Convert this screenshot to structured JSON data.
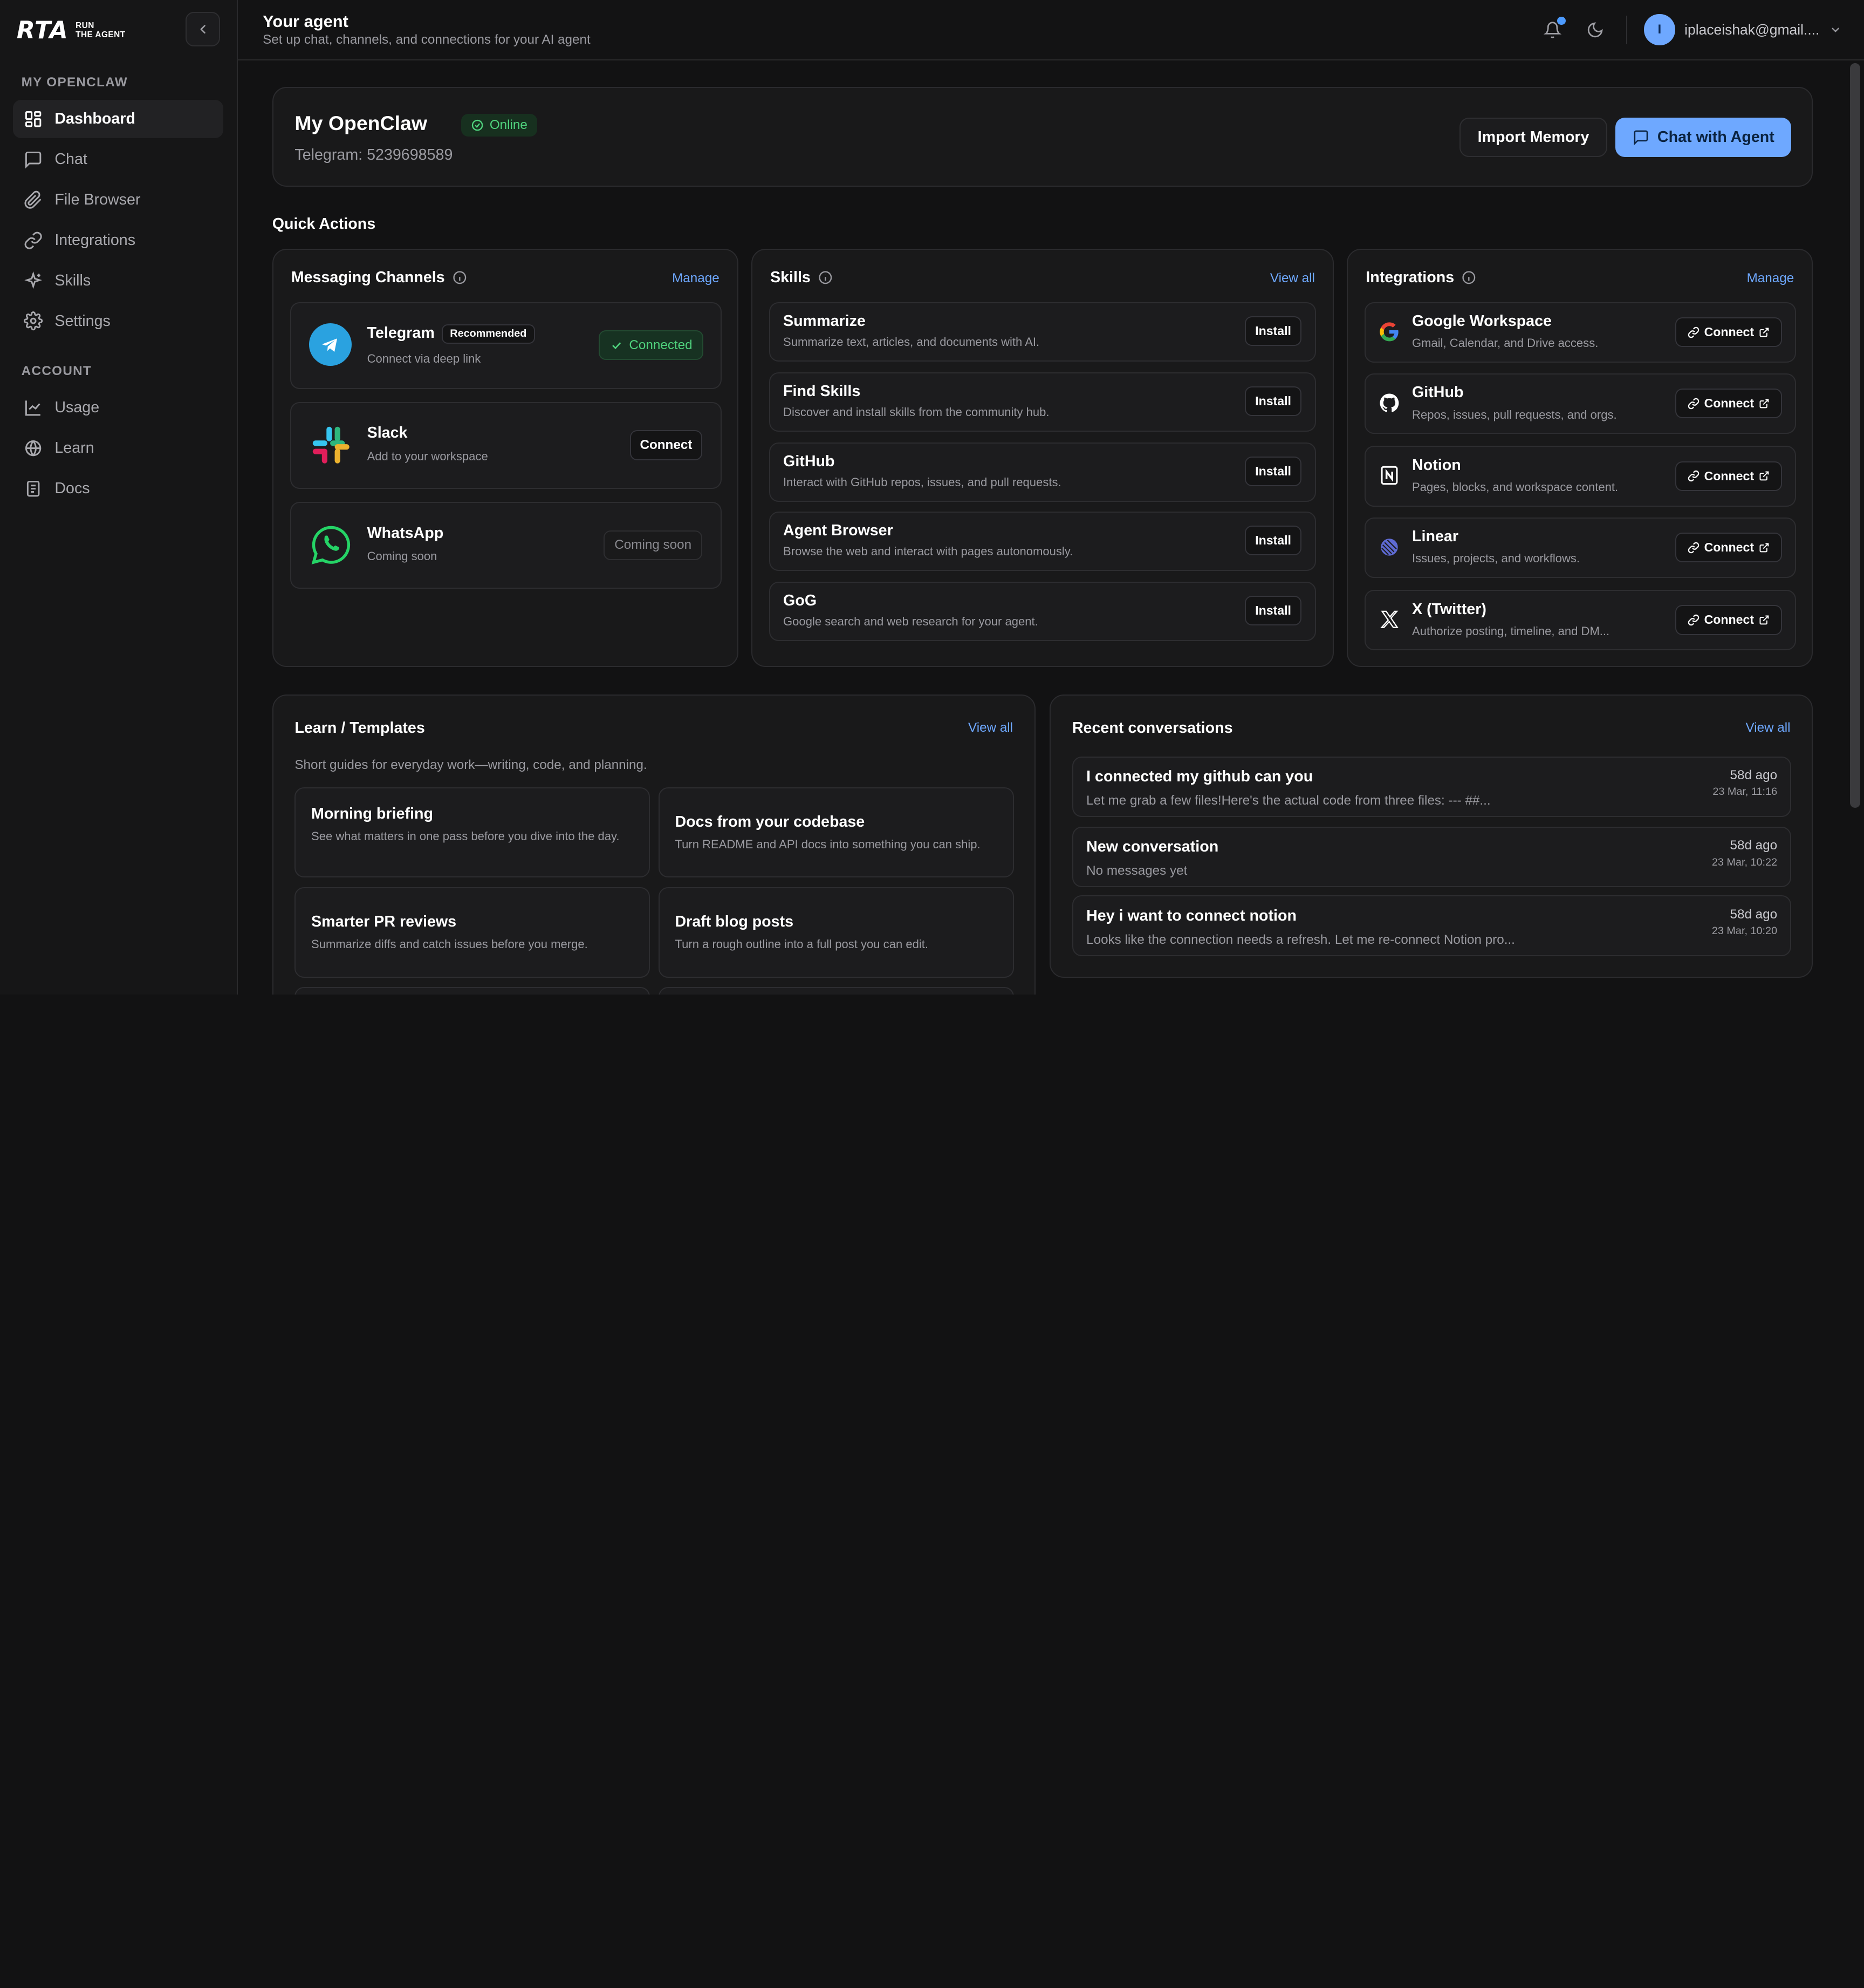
{
  "brand": {
    "logo": "RTA",
    "tagline_1": "RUN",
    "tagline_2": "THE AGENT"
  },
  "sidebar": {
    "section_main": "MY OPENCLAW",
    "section_account": "ACCOUNT",
    "items": [
      {
        "label": "Dashboard",
        "icon": "dashboard-icon",
        "active": true
      },
      {
        "label": "Chat",
        "icon": "chat-icon"
      },
      {
        "label": "File Browser",
        "icon": "paperclip-icon"
      },
      {
        "label": "Integrations",
        "icon": "link-icon"
      },
      {
        "label": "Skills",
        "icon": "sparkle-icon"
      },
      {
        "label": "Settings",
        "icon": "gear-icon"
      }
    ],
    "account_items": [
      {
        "label": "Usage",
        "icon": "chart-icon"
      },
      {
        "label": "Learn",
        "icon": "globe-icon"
      },
      {
        "label": "Docs",
        "icon": "document-icon"
      }
    ]
  },
  "header": {
    "title": "Your agent",
    "subtitle": "Set up chat, channels, and connections for your AI agent",
    "user_initial": "I",
    "user_email": "iplaceishak@gmail...."
  },
  "agent": {
    "name": "My OpenClaw",
    "status": "Online",
    "telegram": "Telegram: 5239698589",
    "import_label": "Import Memory",
    "chat_label": "Chat with Agent"
  },
  "quick_actions": {
    "title": "Quick Actions",
    "messaging": {
      "title": "Messaging Channels",
      "manage": "Manage",
      "channels": [
        {
          "name": "Telegram",
          "badge": "Recommended",
          "desc": "Connect via deep link",
          "action": "Connected"
        },
        {
          "name": "Slack",
          "desc": "Add to your workspace",
          "action": "Connect"
        },
        {
          "name": "WhatsApp",
          "desc": "Coming soon",
          "action": "Coming soon"
        }
      ]
    },
    "skills": {
      "title": "Skills",
      "view_all": "View all",
      "install": "Install",
      "items": [
        {
          "name": "Summarize",
          "desc": "Summarize text, articles, and documents with AI."
        },
        {
          "name": "Find Skills",
          "desc": "Discover and install skills from the community hub."
        },
        {
          "name": "GitHub",
          "desc": "Interact with GitHub repos, issues, and pull requests."
        },
        {
          "name": "Agent Browser",
          "desc": "Browse the web and interact with pages autonomously."
        },
        {
          "name": "GoG",
          "desc": "Google search and web research for your agent."
        }
      ]
    },
    "integrations": {
      "title": "Integrations",
      "manage": "Manage",
      "connect": "Connect",
      "items": [
        {
          "name": "Google Workspace",
          "desc": "Gmail, Calendar, and Drive access.",
          "icon": "google-icon"
        },
        {
          "name": "GitHub",
          "desc": "Repos, issues, pull requests, and orgs.",
          "icon": "github-icon"
        },
        {
          "name": "Notion",
          "desc": "Pages, blocks, and workspace content.",
          "icon": "notion-icon"
        },
        {
          "name": "Linear",
          "desc": "Issues, projects, and workflows.",
          "icon": "linear-icon"
        },
        {
          "name": "X (Twitter)",
          "desc": "Authorize posting, timeline, and DM...",
          "icon": "x-icon"
        }
      ]
    }
  },
  "learn": {
    "title": "Learn / Templates",
    "view_all": "View all",
    "subtitle": "Short guides for everyday work—writing, code, and planning.",
    "templates": [
      {
        "title": "Morning briefing",
        "desc": "See what matters in one pass before you dive into the day."
      },
      {
        "title": "Docs from your codebase",
        "desc": "Turn README and API docs into something you can ship."
      },
      {
        "title": "Smarter PR reviews",
        "desc": "Summarize diffs and catch issues before you merge."
      },
      {
        "title": "Draft blog posts",
        "desc": "Turn a rough outline into a full post you can edit."
      }
    ]
  },
  "recent": {
    "title": "Recent conversations",
    "view_all": "View all",
    "items": [
      {
        "title": "I connected my github can you",
        "preview": "Let me grab a few files!Here's the actual code from three files: --- ##...",
        "age": "58d ago",
        "date": "23 Mar, 11:16"
      },
      {
        "title": "New conversation",
        "preview": "No messages yet",
        "age": "58d ago",
        "date": "23 Mar, 10:22"
      },
      {
        "title": "Hey i want to connect notion",
        "preview": "Looks like the connection needs a refresh. Let me re-connect Notion pro...",
        "age": "58d ago",
        "date": "23 Mar, 10:20"
      }
    ]
  }
}
